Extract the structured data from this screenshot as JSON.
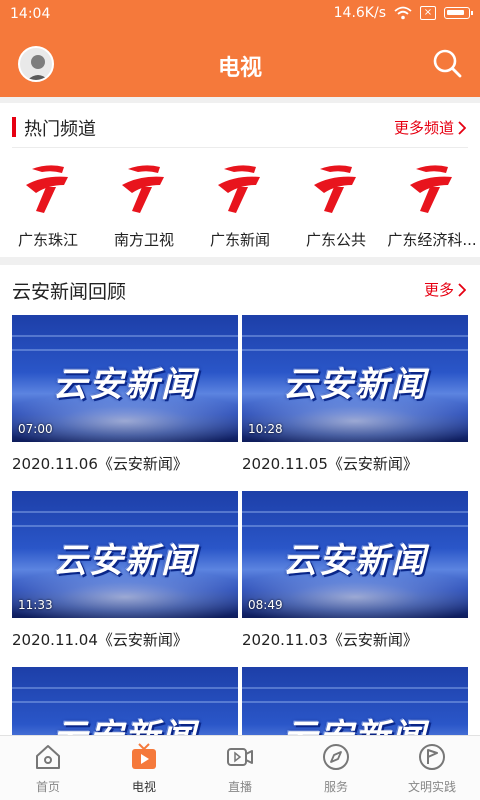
{
  "status_bar": {
    "time": "14:04",
    "speed": "14.6K/s"
  },
  "header": {
    "title": "电视"
  },
  "hot_channels": {
    "title": "热门频道",
    "more": "更多频道",
    "items": [
      {
        "name": "广东珠江"
      },
      {
        "name": "南方卫视"
      },
      {
        "name": "广东新闻"
      },
      {
        "name": "广东公共"
      },
      {
        "name": "广东经济科..."
      }
    ]
  },
  "news_review": {
    "title": "云安新闻回顾",
    "more": "更多",
    "items": [
      {
        "thumb_text": "云安新闻",
        "duration": "07:00",
        "caption": "2020.11.06《云安新闻》"
      },
      {
        "thumb_text": "云安新闻",
        "duration": "10:28",
        "caption": "2020.11.05《云安新闻》"
      },
      {
        "thumb_text": "云安新闻",
        "duration": "11:33",
        "caption": "2020.11.04《云安新闻》"
      },
      {
        "thumb_text": "云安新闻",
        "duration": "08:49",
        "caption": "2020.11.03《云安新闻》"
      },
      {
        "thumb_text": "云安新闻",
        "duration": "",
        "caption": ""
      },
      {
        "thumb_text": "云安新闻",
        "duration": "",
        "caption": ""
      }
    ]
  },
  "bottom_nav": {
    "items": [
      {
        "label": "首页",
        "icon": "home-icon",
        "active": false
      },
      {
        "label": "电视",
        "icon": "tv-play-icon",
        "active": true
      },
      {
        "label": "直播",
        "icon": "video-camera-icon",
        "active": false
      },
      {
        "label": "服务",
        "icon": "compass-icon",
        "active": false
      },
      {
        "label": "文明实践",
        "icon": "flag-icon",
        "active": false
      }
    ]
  },
  "colors": {
    "brand_orange": "#f5793b",
    "accent_red": "#e60012",
    "channel_logo_red": "#e8141d"
  }
}
